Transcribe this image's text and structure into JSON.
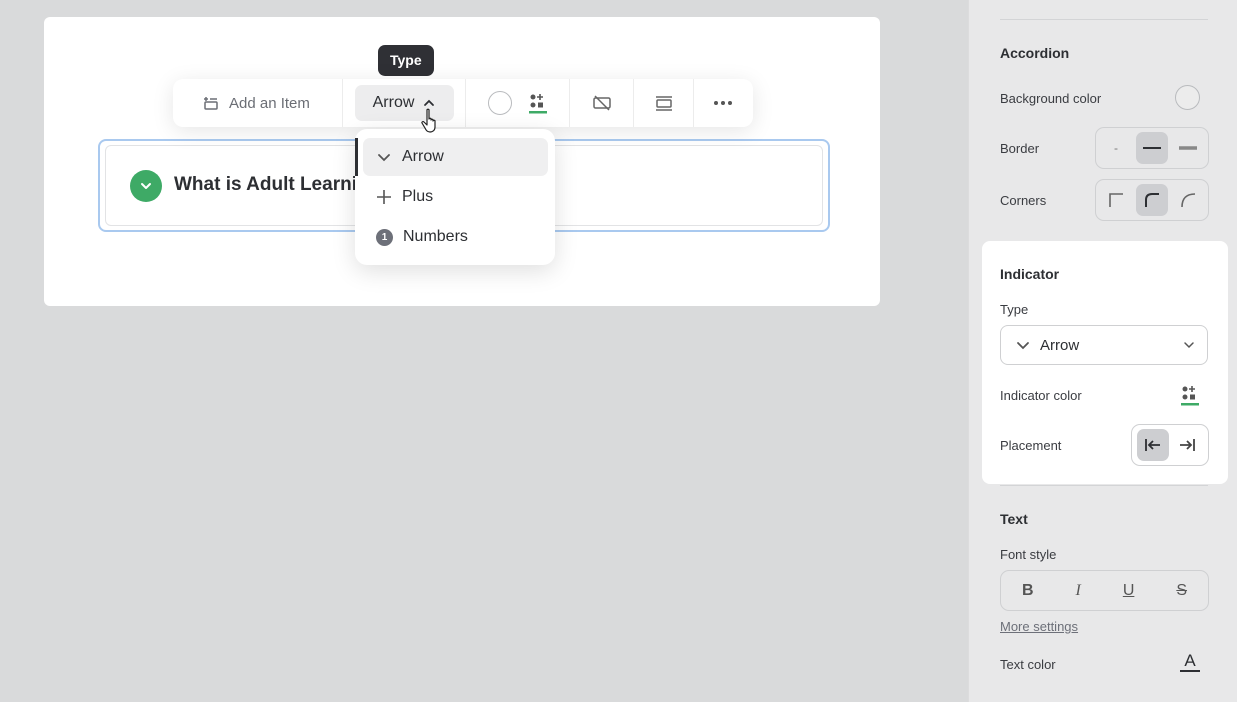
{
  "tooltip": {
    "text": "Type"
  },
  "toolbar": {
    "add_item_label": "Add an Item",
    "type_label": "Arrow",
    "icons": [
      "add-item-icon",
      "chevron-up-icon",
      "color-circle-icon",
      "indicator-color-icon",
      "hide-border-icon",
      "layout-icon",
      "more-icon"
    ]
  },
  "accordion": {
    "item_title": "What is Adult Learni",
    "indicator_color": "#3eaa66",
    "selection_border_color": "#a9c9ef"
  },
  "dropdown": {
    "options": [
      {
        "label": "Arrow",
        "icon": "chevron-down-icon",
        "active": true
      },
      {
        "label": "Plus",
        "icon": "plus-icon",
        "active": false
      },
      {
        "label": "Numbers",
        "icon": "number-one-icon",
        "badge": "1",
        "active": false
      }
    ]
  },
  "panel": {
    "accordion_heading": "Accordion",
    "background_color_label": "Background color",
    "border_label": "Border",
    "border_options": [
      "-",
      "thin",
      "thick"
    ],
    "border_selected": "thin",
    "corners_label": "Corners",
    "corners_selected": "medium",
    "indicator_heading": "Indicator",
    "type_label": "Type",
    "type_value": "Arrow",
    "indicator_color_label": "Indicator color",
    "placement_label": "Placement",
    "placement_selected": "left",
    "text_heading": "Text",
    "font_style_label": "Font style",
    "font_buttons": [
      "B",
      "I",
      "U",
      "S"
    ],
    "more_settings": "More settings",
    "text_color_label": "Text color",
    "text_color_glyph": "A"
  }
}
